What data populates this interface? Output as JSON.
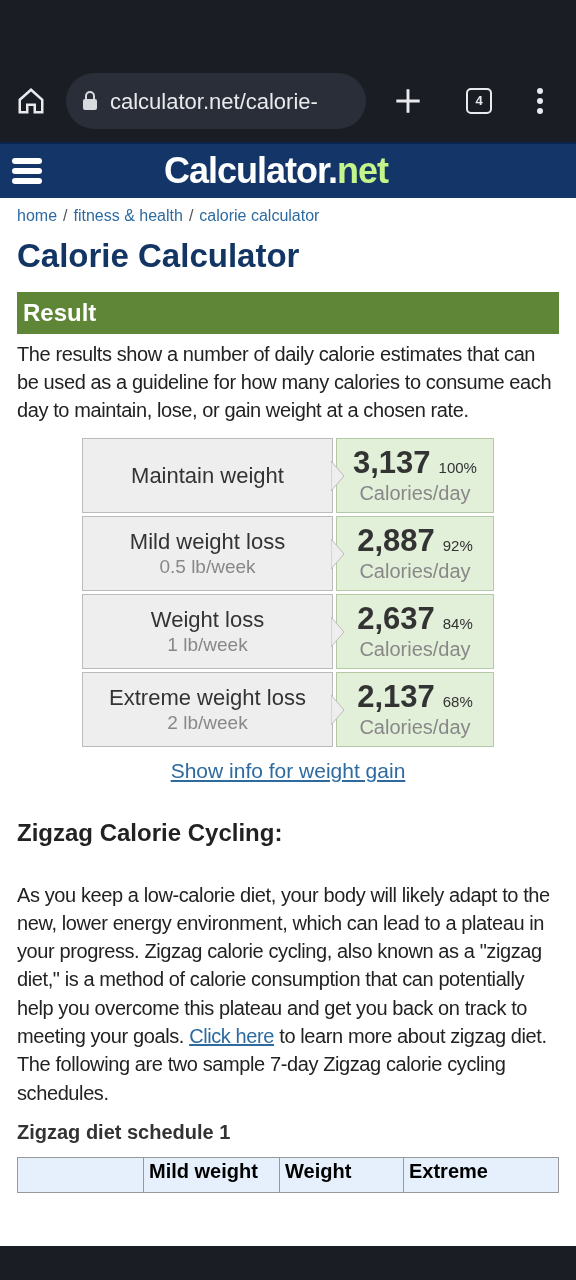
{
  "browser": {
    "url": "calculator.net/calorie-",
    "tab_count": "4"
  },
  "site": {
    "logo_main": "Calculator.",
    "logo_accent": "net"
  },
  "breadcrumb_separator": "/",
  "breadcrumb": [
    {
      "label": "home"
    },
    {
      "label": "fitness & health"
    },
    {
      "label": "calorie calculator"
    }
  ],
  "title": "Calorie Calculator",
  "result": {
    "heading": "Result",
    "intro": "The results show a number of daily calorie estimates that can be used as a guideline for how many calories to consume each day to maintain, lose, or gain weight at a chosen rate.",
    "rows": [
      {
        "label": "Maintain weight",
        "calories": "3,137",
        "percent": "100%",
        "unit": "Calories/day"
      },
      {
        "label": "Mild weight loss",
        "rate": "0.5 lb/week",
        "calories": "2,887",
        "percent": "92%",
        "unit": "Calories/day"
      },
      {
        "label": "Weight loss",
        "rate": "1 lb/week",
        "calories": "2,637",
        "percent": "84%",
        "unit": "Calories/day"
      },
      {
        "label": "Extreme weight loss",
        "rate": "2 lb/week",
        "calories": "2,137",
        "percent": "68%",
        "unit": "Calories/day"
      }
    ],
    "gain_link": "Show info for weight gain"
  },
  "zigzag": {
    "heading": "Zigzag Calorie Cycling:",
    "text_before": "As you keep a low-calorie diet, your body will likely adapt to the new, lower energy environment, which can lead to a plateau in your progress. Zigzag calorie cycling, also known as a \"zigzag diet,\" is a method of calorie consumption that can potentially help you overcome this plateau and get you back on track to meeting your goals.",
    "link": "Click here",
    "text_after": "to learn more about zigzag diet. The following are two sample 7-day Zigzag calorie cycling schedules.",
    "schedule_title": "Zigzag diet schedule 1",
    "columns": [
      "Mild weight",
      "Weight",
      "Extreme"
    ]
  }
}
